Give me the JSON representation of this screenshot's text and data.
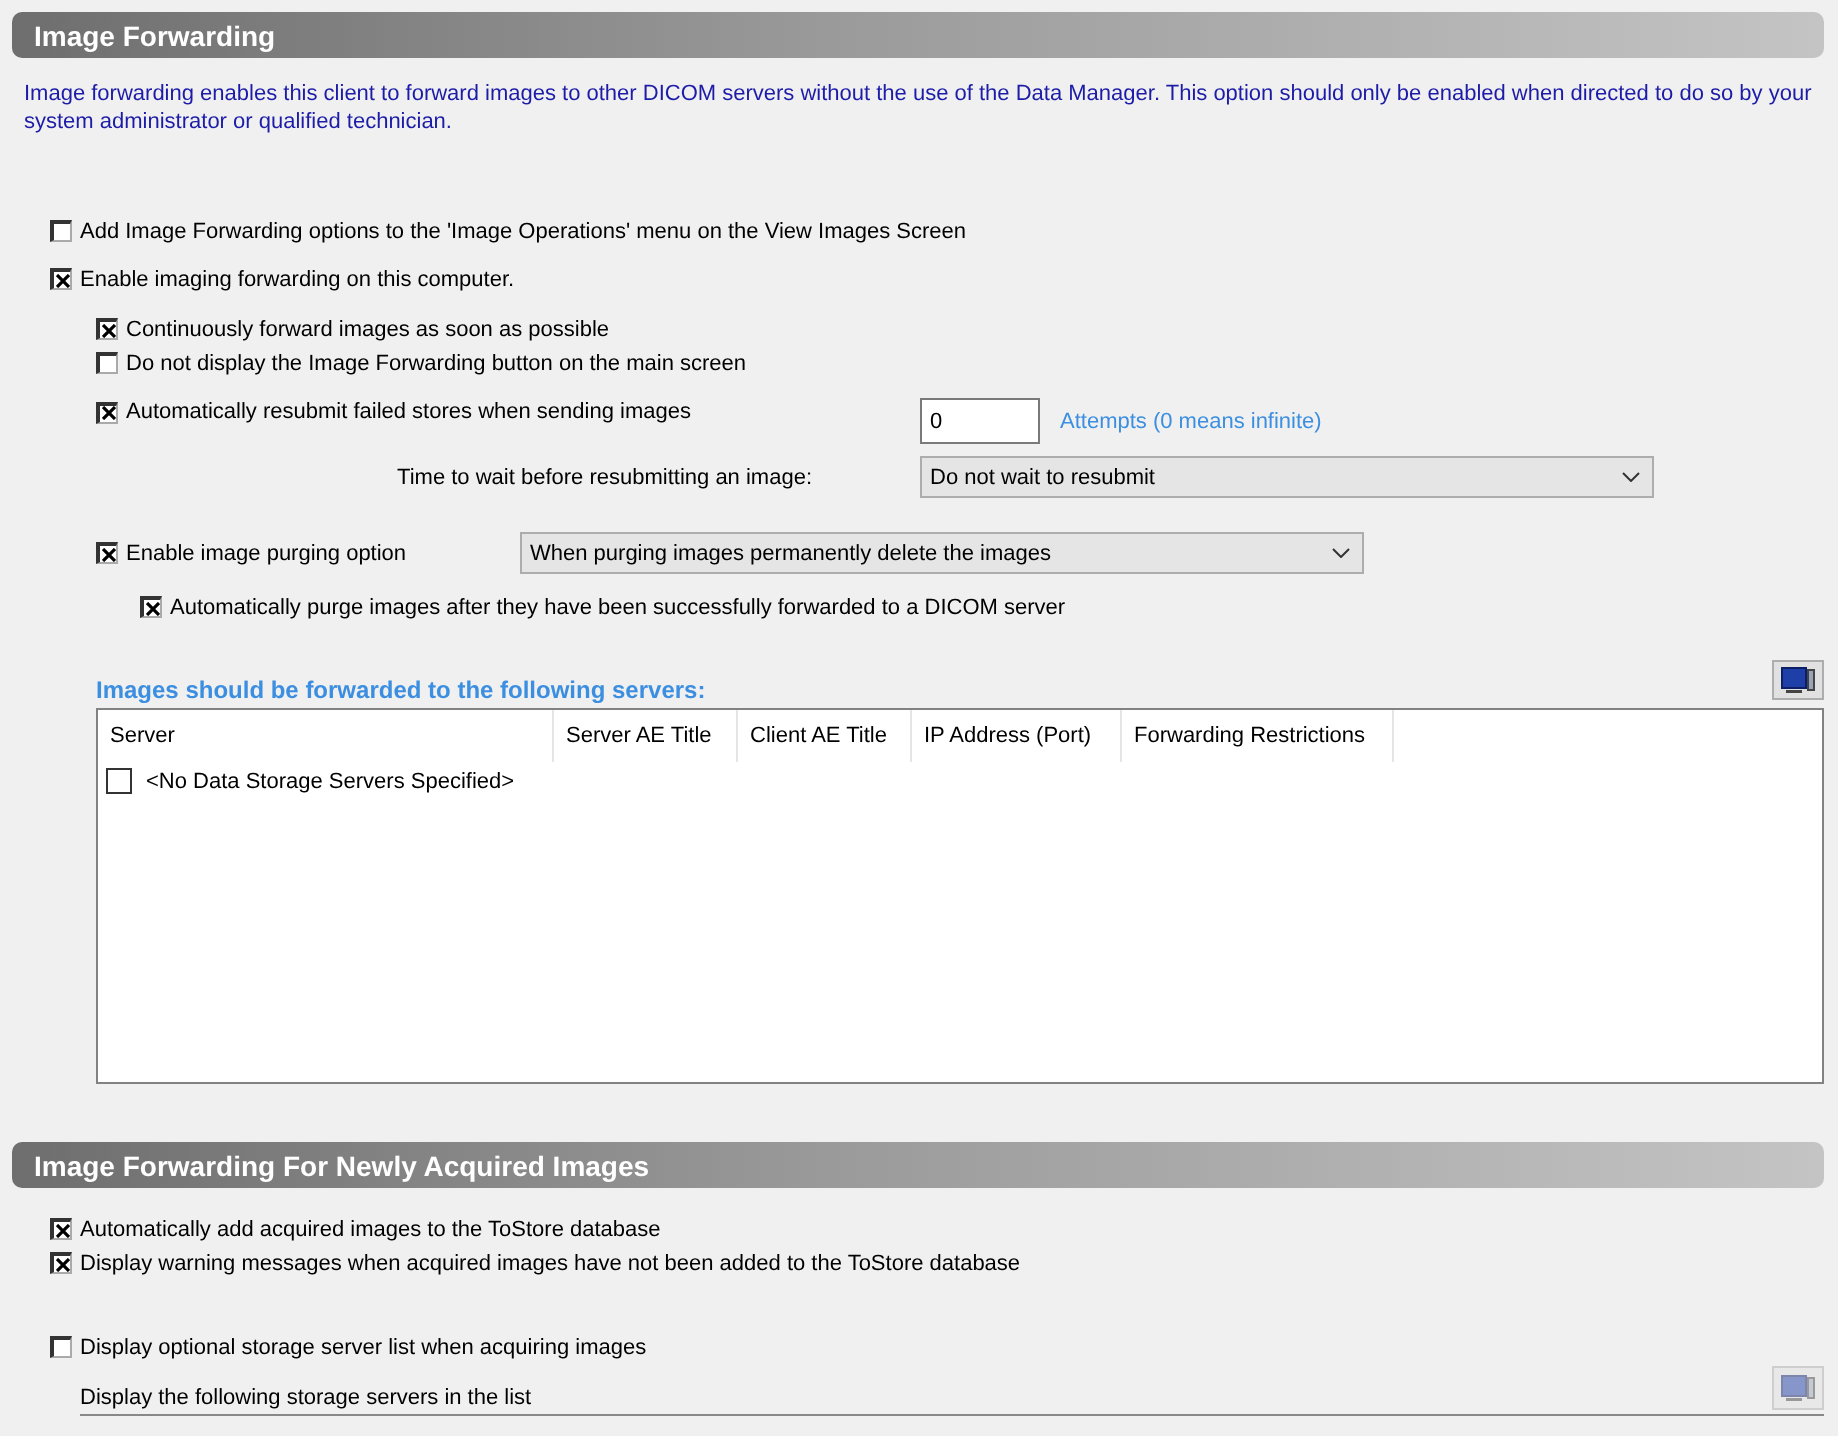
{
  "forwarding": {
    "title": "Image Forwarding",
    "description": "Image forwarding enables this client to forward images to other DICOM servers without the use of the Data Manager.  This option should only be enabled when directed to do so by your system administrator or qualified technician.",
    "add_menu_option": {
      "label": "Add Image Forwarding options to the 'Image Operations' menu on the View Images Screen",
      "checked": false
    },
    "enable": {
      "label": "Enable imaging forwarding on this computer.",
      "checked": true
    },
    "continuous": {
      "label": "Continuously forward images as soon as possible",
      "checked": true
    },
    "hide_button": {
      "label": "Do not display the Image Forwarding button on the main screen",
      "checked": false
    },
    "resubmit": {
      "label": "Automatically resubmit failed stores when sending images",
      "checked": true,
      "attempts_value": "0",
      "attempts_hint": "Attempts (0 means infinite)"
    },
    "wait": {
      "label": "Time to wait before resubmitting an image:",
      "value": "Do not wait to resubmit"
    },
    "purging": {
      "label": "Enable image purging option",
      "checked": true,
      "value": "When purging images permanently delete the images"
    },
    "auto_purge": {
      "label": "Automatically purge images after they have been successfully forwarded to a DICOM server",
      "checked": true
    },
    "servers": {
      "heading": "Images should be forwarded to the following servers:",
      "columns": [
        "Server",
        "Server AE Title",
        "Client AE Title",
        "IP Address (Port)",
        "Forwarding Restrictions"
      ],
      "rows": [
        {
          "server": "<No Data Storage Servers Specified>",
          "checked": false
        }
      ]
    }
  },
  "acquired": {
    "title": "Image Forwarding For Newly Acquired Images",
    "options": [
      {
        "label": "Automatically add acquired images to the ToStore database",
        "checked": true
      },
      {
        "label": "Display warning messages when acquired images have not been added to the ToStore database",
        "checked": true
      }
    ],
    "optional_list": {
      "label": "Display optional storage server list when acquiring images",
      "checked": false
    },
    "list_caption": "Display the following storage servers in the list"
  }
}
